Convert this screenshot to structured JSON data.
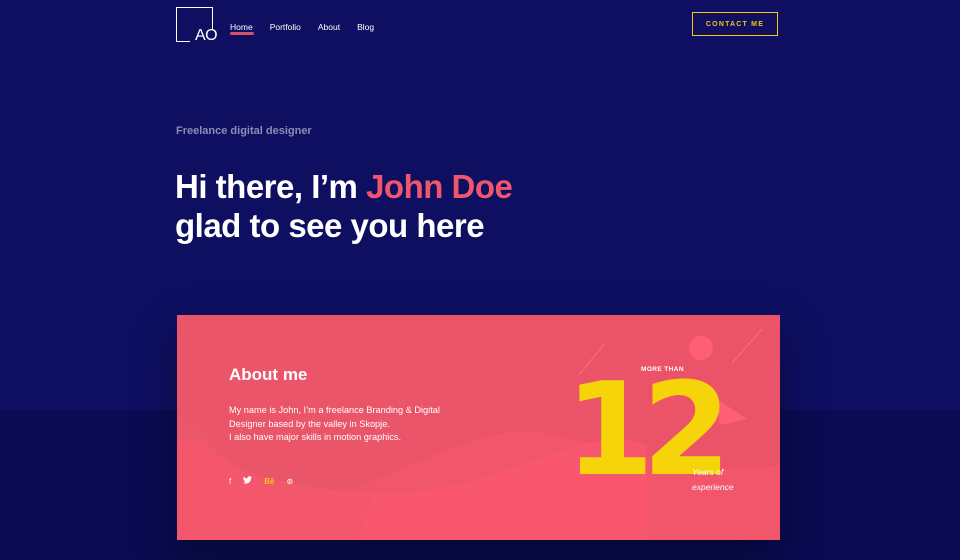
{
  "header": {
    "logo_text": "AO",
    "nav": [
      {
        "label": "Home",
        "active": true
      },
      {
        "label": "Portfolio",
        "active": false
      },
      {
        "label": "About",
        "active": false
      },
      {
        "label": "Blog",
        "active": false
      }
    ],
    "contact_label": "CONTACT ME"
  },
  "hero": {
    "subtitle": "Freelance digital designer",
    "greeting": "Hi there, I’m ",
    "name": "John Doe",
    "line2": "glad to see you here"
  },
  "about": {
    "title": "About me",
    "text_lines": [
      "My name is John, I’m a freelance Branding & Digital",
      "Designer based by the valley in Skopje.",
      "I also have major skills in motion graphics."
    ],
    "socials": [
      {
        "icon": "facebook-icon",
        "glyph": "f"
      },
      {
        "icon": "twitter-icon",
        "glyph": "🐦"
      },
      {
        "icon": "behance-icon",
        "glyph": "Bē"
      },
      {
        "icon": "dribbble-icon",
        "glyph": "⊛"
      }
    ],
    "more_than": "MORE THAN",
    "number": "12",
    "years_line1": "Years of",
    "years_line2": "experience"
  },
  "colors": {
    "background": "#0e0f61",
    "accent": "#f0566b",
    "yellow": "#f5d40a",
    "card": "#eb5468"
  }
}
